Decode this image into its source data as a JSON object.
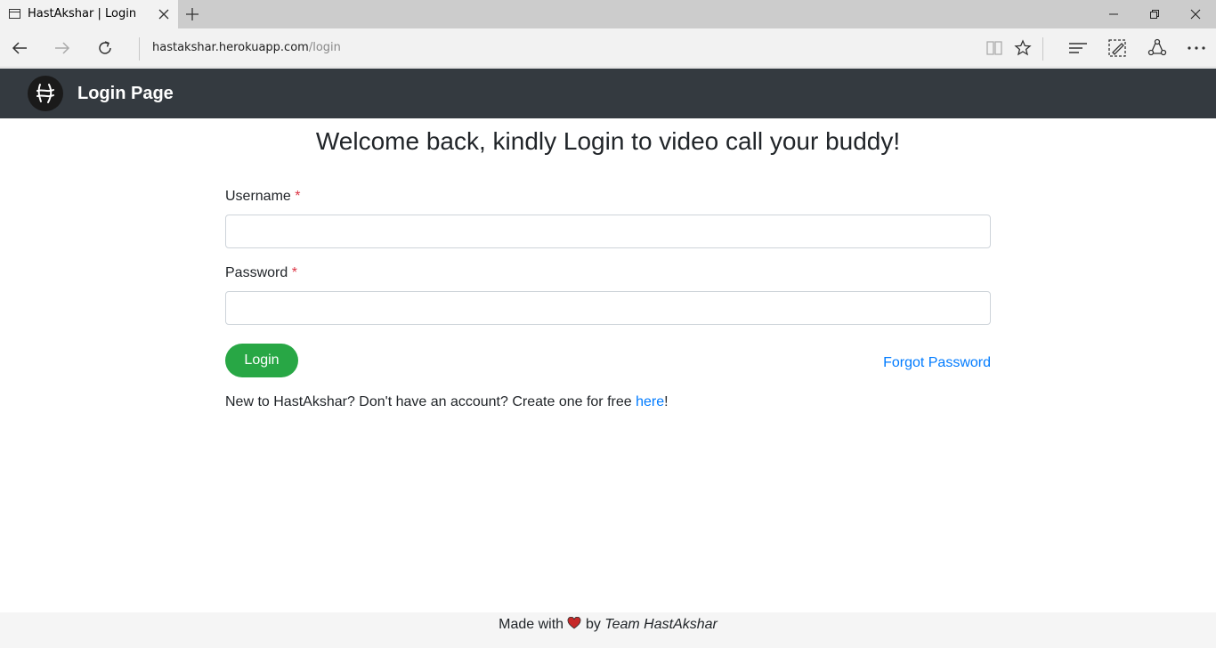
{
  "browser": {
    "tab_title": "HastAkshar | Login",
    "url_host": "hastakshar.herokuapp.com",
    "url_path": "/login"
  },
  "navbar": {
    "brand": "Login Page",
    "logo_icon": "hastakshar-logo-icon"
  },
  "main": {
    "heading": "Welcome back, kindly Login to video call your buddy!",
    "username_label": "Username",
    "password_label": "Password",
    "required_marker": "*",
    "username_value": "",
    "password_value": "",
    "login_button": "Login",
    "forgot_link": "Forgot Password",
    "signup_text": "New to HastAkshar? Don't have an account? Create one for free ",
    "signup_link": "here",
    "signup_suffix": "!"
  },
  "footer": {
    "made_with": "Made with",
    "heart_icon": "heart-icon",
    "by": "by",
    "team": "Team HastAkshar"
  },
  "colors": {
    "navbar_bg": "#343a40",
    "login_button_bg": "#28a745",
    "link": "#007bff",
    "required": "#dc3545"
  }
}
